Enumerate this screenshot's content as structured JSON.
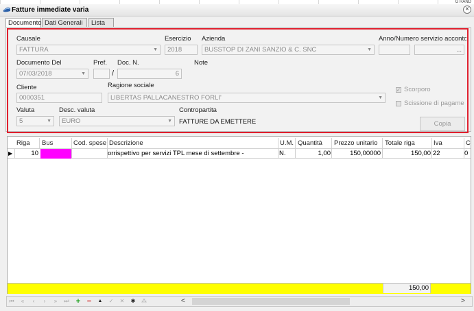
{
  "window": {
    "title": "Fatture immediate varia",
    "top_right_fragment": "G RAND"
  },
  "tabs": [
    {
      "label": "Documento",
      "active": true
    },
    {
      "label": "Dati Generali",
      "active": false
    },
    {
      "label": "Lista",
      "active": false
    }
  ],
  "form": {
    "causale": {
      "label": "Causale",
      "value": "FATTURA"
    },
    "esercizio": {
      "label": "Esercizio",
      "value": "2018"
    },
    "azienda": {
      "label": "Azienda",
      "value": "BUSSTOP DI ZANI SANZIO & C. SNC"
    },
    "anno_numero": {
      "label": "Anno/Numero servizio acconto",
      "value_year": "",
      "button": "..."
    },
    "documento_del": {
      "label": "Documento Del",
      "value": "07/03/2018"
    },
    "pref": {
      "label": "Pref.",
      "value": "",
      "separator": "/"
    },
    "doc_n": {
      "label": "Doc. N.",
      "value": "6"
    },
    "note": {
      "label": "Note"
    },
    "cliente": {
      "label": "Cliente",
      "value": "0000351"
    },
    "ragione_sociale": {
      "label": "Ragione sociale",
      "value": "LIBERTAS PALLACANESTRO FORLI'"
    },
    "scorporo": {
      "label": "Scorporo",
      "checked": true
    },
    "scissione": {
      "label": "Scissione di pagame",
      "checked": false
    },
    "valuta": {
      "label": "Valuta",
      "value": "5"
    },
    "desc_valuta": {
      "label": "Desc. valuta",
      "value": "EURO"
    },
    "contropartita": {
      "label": "Contropartita",
      "value": "FATTURE DA EMETTERE"
    },
    "copia_button": "Copia"
  },
  "grid": {
    "columns": [
      "Riga",
      "Bus",
      "Cod. spese",
      "Descrizione",
      "U.M.",
      "Quantità",
      "Prezzo unitario",
      "Totale riga",
      "Iva",
      "C"
    ],
    "rows": [
      {
        "indicator": "▶",
        "riga": "10",
        "bus": "",
        "cod_spese": "",
        "descrizione": "orrispettivo per servizi TPL mese di settembre  -",
        "um": "N.",
        "quantita": "1,00",
        "prezzo": "150,00000",
        "totale": "150,00",
        "iva": "22",
        "c": "0"
      }
    ],
    "bus_cell_color": "#ff00ff",
    "footer_total": "150,00",
    "footer_color": "#ffff00"
  },
  "navigator": {
    "buttons": [
      "first-icon",
      "prior-page-icon",
      "prior-icon",
      "next-icon",
      "next-page-icon",
      "last-icon",
      "insert-icon",
      "delete-icon",
      "edit-icon",
      "post-icon",
      "cancel-icon",
      "refresh-icon",
      "apply-filter-icon"
    ],
    "scroll_left": "<",
    "scroll_right": ">"
  }
}
